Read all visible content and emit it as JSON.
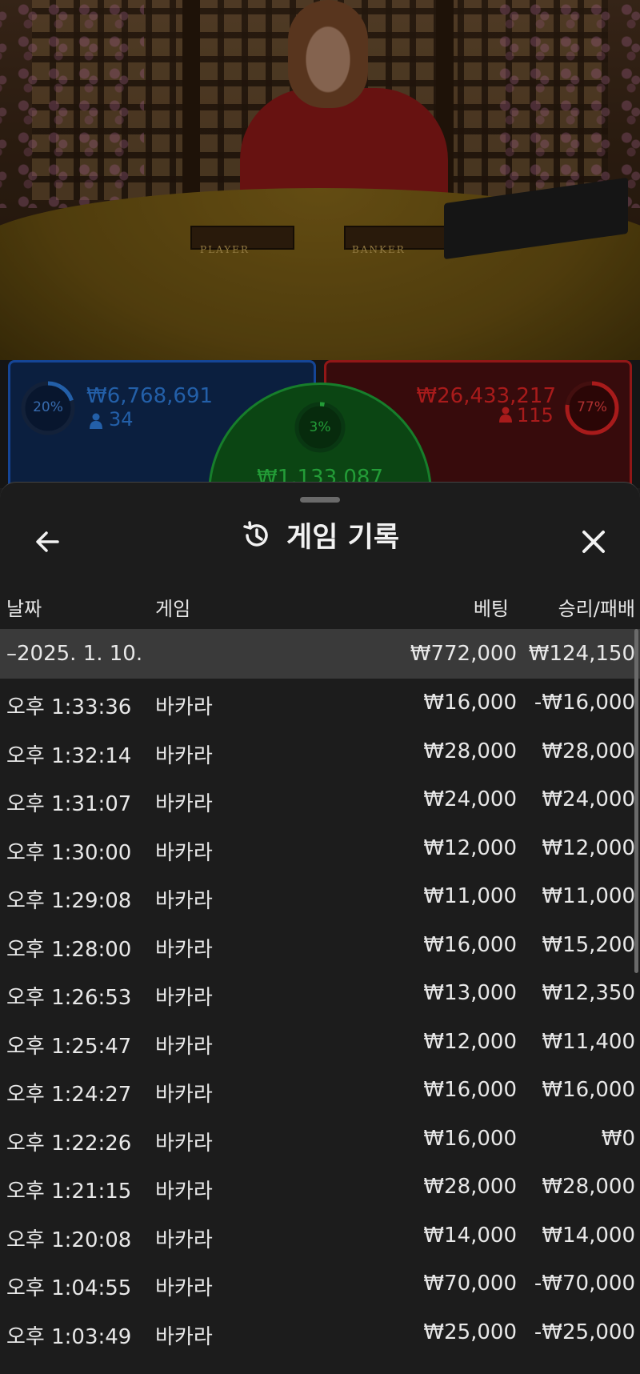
{
  "stream": {
    "player_label": "PLAYER",
    "banker_label": "BANKER"
  },
  "bets": {
    "player": {
      "percent": "20%",
      "percent_value": 0.2,
      "amount": "₩6,768,691",
      "players": "34",
      "color": "#2f7fe0"
    },
    "banker": {
      "percent": "77%",
      "percent_value": 0.77,
      "amount": "₩26,433,217",
      "players": "115",
      "color": "#e02424"
    },
    "tie": {
      "percent": "3%",
      "percent_value": 0.03,
      "amount": "₩1,133,087",
      "color": "#2fd14a"
    }
  },
  "sheet": {
    "title": "게임 기록",
    "title_icon": "history-icon",
    "back_icon": "arrow-left-icon",
    "close_icon": "close-icon",
    "columns": {
      "date": "날짜",
      "game": "게임",
      "bet": "베팅",
      "result": "승리/패배"
    },
    "group": {
      "date": "–2025. 1. 10.",
      "bet": "₩772,000",
      "result": "₩124,150"
    },
    "rows": [
      {
        "time": "오후 1:33:36",
        "game": "바카라",
        "bet": "₩16,000",
        "result": "-₩16,000"
      },
      {
        "time": "오후 1:32:14",
        "game": "바카라",
        "bet": "₩28,000",
        "result": "₩28,000"
      },
      {
        "time": "오후 1:31:07",
        "game": "바카라",
        "bet": "₩24,000",
        "result": "₩24,000"
      },
      {
        "time": "오후 1:30:00",
        "game": "바카라",
        "bet": "₩12,000",
        "result": "₩12,000"
      },
      {
        "time": "오후 1:29:08",
        "game": "바카라",
        "bet": "₩11,000",
        "result": "₩11,000"
      },
      {
        "time": "오후 1:28:00",
        "game": "바카라",
        "bet": "₩16,000",
        "result": "₩15,200"
      },
      {
        "time": "오후 1:26:53",
        "game": "바카라",
        "bet": "₩13,000",
        "result": "₩12,350"
      },
      {
        "time": "오후 1:25:47",
        "game": "바카라",
        "bet": "₩12,000",
        "result": "₩11,400"
      },
      {
        "time": "오후 1:24:27",
        "game": "바카라",
        "bet": "₩16,000",
        "result": "₩16,000"
      },
      {
        "time": "오후 1:22:26",
        "game": "바카라",
        "bet": "₩16,000",
        "result": "₩0"
      },
      {
        "time": "오후 1:21:15",
        "game": "바카라",
        "bet": "₩28,000",
        "result": "₩28,000"
      },
      {
        "time": "오후 1:20:08",
        "game": "바카라",
        "bet": "₩14,000",
        "result": "₩14,000"
      },
      {
        "time": "오후 1:04:55",
        "game": "바카라",
        "bet": "₩70,000",
        "result": "-₩70,000"
      },
      {
        "time": "오후 1:03:49",
        "game": "바카라",
        "bet": "₩25,000",
        "result": "-₩25,000"
      }
    ]
  }
}
